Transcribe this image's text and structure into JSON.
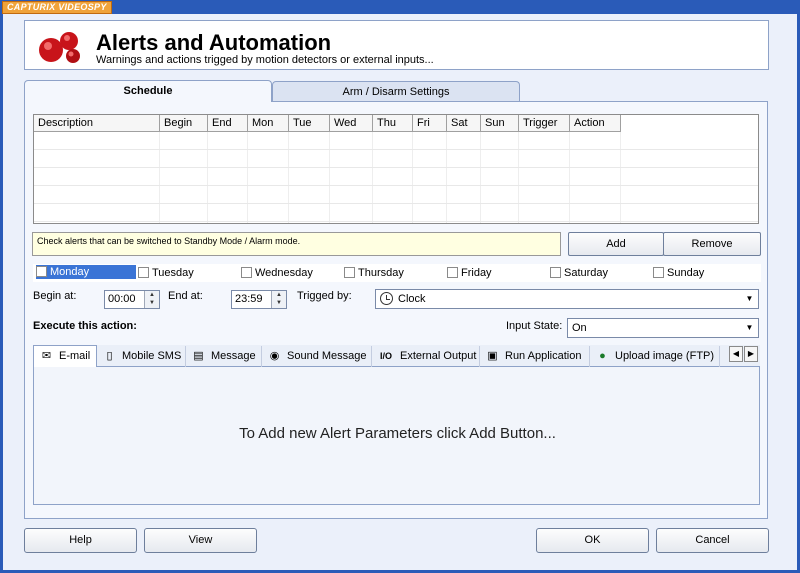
{
  "brand": "CAPTURIX VIDEOSPY",
  "header": {
    "title": "Alerts and Automation",
    "subtitle": "Warnings and actions trigged by motion detectors or external inputs..."
  },
  "tabs": [
    {
      "label": "Schedule"
    },
    {
      "label": "Arm / Disarm Settings"
    }
  ],
  "grid": {
    "columns": [
      "Description",
      "Begin",
      "End",
      "Mon",
      "Tue",
      "Wed",
      "Thu",
      "Fri",
      "Sat",
      "Sun",
      "Trigger",
      "Action"
    ],
    "rows": []
  },
  "hint": "Check alerts that can be switched to Standby Mode / Alarm mode.",
  "buttons": {
    "add": "Add",
    "remove": "Remove"
  },
  "days": [
    {
      "label": "Monday",
      "checked": false
    },
    {
      "label": "Tuesday",
      "checked": false
    },
    {
      "label": "Wednesday",
      "checked": false
    },
    {
      "label": "Thursday",
      "checked": false
    },
    {
      "label": "Friday",
      "checked": false
    },
    {
      "label": "Saturday",
      "checked": false
    },
    {
      "label": "Sunday",
      "checked": false
    }
  ],
  "schedule": {
    "begin_label": "Begin at:",
    "begin_value": "00:00",
    "end_label": "End at:",
    "end_value": "23:59",
    "trigger_label": "Trigged by:",
    "trigger_value": "Clock"
  },
  "execute_label": "Execute this action:",
  "input_state": {
    "label": "Input State:",
    "value": "On"
  },
  "action_tabs": [
    {
      "label": "E-mail",
      "icon": "email-icon"
    },
    {
      "label": "Mobile SMS",
      "icon": "mobile-phone-icon"
    },
    {
      "label": "Message",
      "icon": "message-window-icon"
    },
    {
      "label": "Sound Message",
      "icon": "speaker-icon"
    },
    {
      "label": "External Output",
      "icon": "io-icon"
    },
    {
      "label": "Run Application",
      "icon": "application-icon"
    },
    {
      "label": "Upload image (FTP)",
      "icon": "globe-icon"
    }
  ],
  "content_message": "To Add new Alert Parameters click Add Button...",
  "footer": {
    "help": "Help",
    "view": "View",
    "ok": "OK",
    "cancel": "Cancel"
  }
}
